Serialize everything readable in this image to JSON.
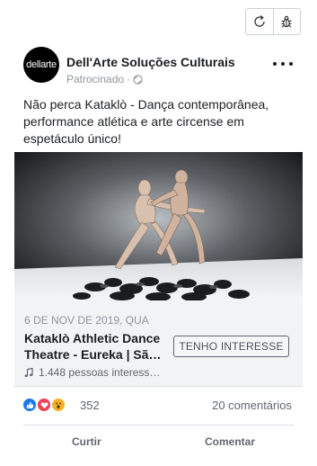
{
  "page": {
    "name": "Dell'Arte Soluções Culturais",
    "sponsored_label": "Patrocinado",
    "separator": "·",
    "avatar_text": "dellarte"
  },
  "post": {
    "text": "Não perca Kataklò - Dança contemporânea, performance atlética e arte circense em espetáculo único!"
  },
  "event": {
    "date": "6 DE NOV DE 2019, QUA",
    "title_line1": "Kataklò Athletic Dance",
    "title_line2": "Theatre - Eureka | Sã…",
    "interested": "1.448 pessoas interess…",
    "interest_button": "TENHO INTERESSE"
  },
  "engagement": {
    "reactions_count": "352",
    "comments": "20 comentários"
  },
  "actions": {
    "like": "Curtir",
    "comment": "Comentar"
  },
  "colors": {
    "brand_blue": "#1877f2",
    "love": "#f33e58",
    "wow": "#f7b125",
    "muted_text": "#90949c"
  },
  "icons": [
    "refresh-icon",
    "bug-icon",
    "globe-icon",
    "more-icon",
    "music-note-icon",
    "like-reaction-icon",
    "love-reaction-icon",
    "wow-reaction-icon"
  ]
}
